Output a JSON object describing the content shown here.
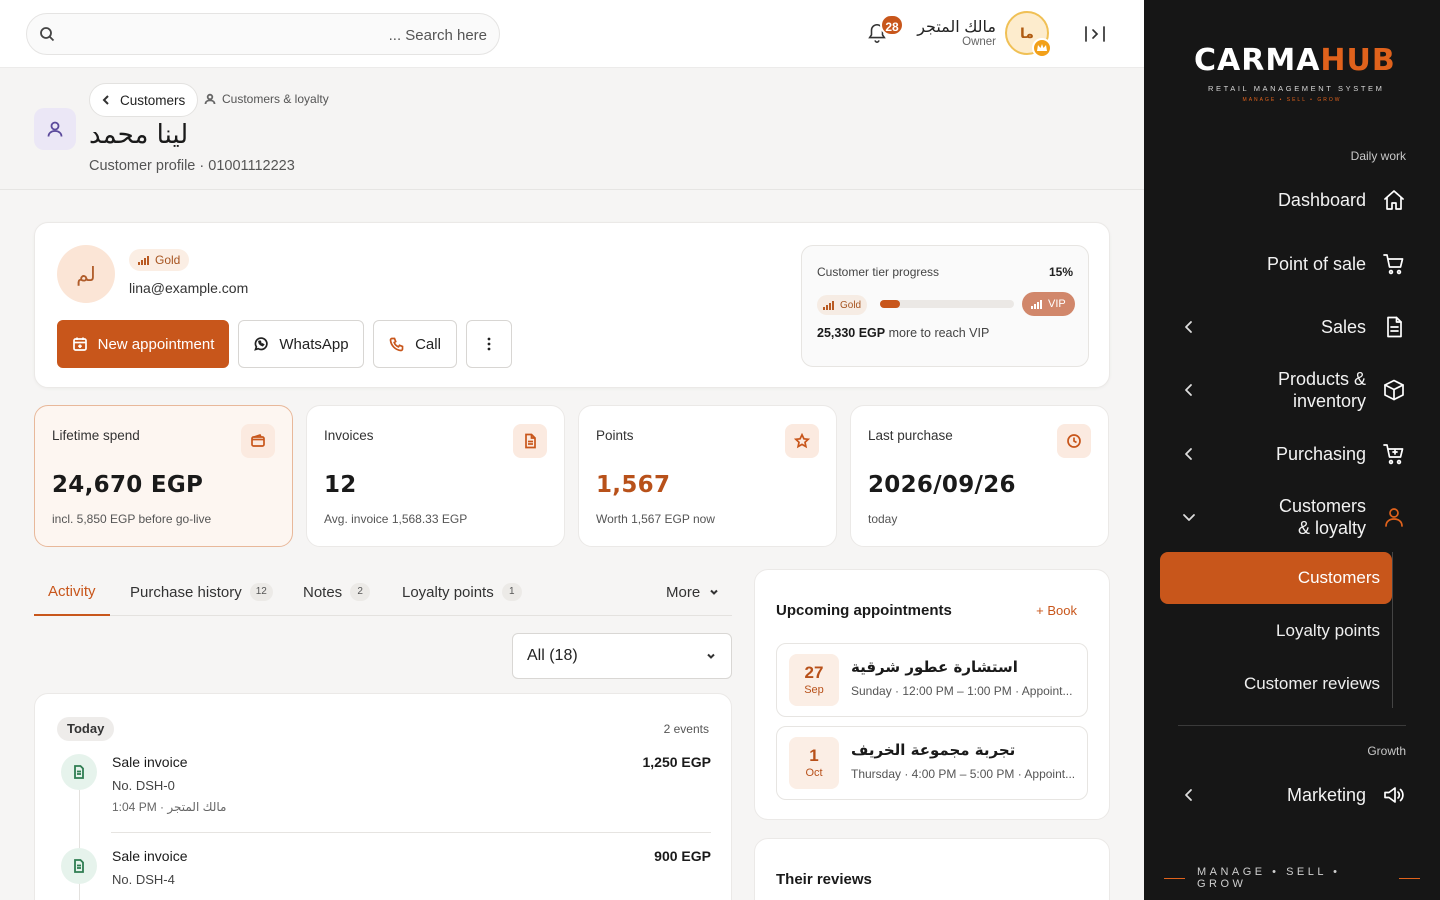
{
  "topbar": {
    "search_placeholder": "... Search here",
    "notifications_count": "28",
    "user_name": "مالك المتجر",
    "user_role": "Owner",
    "user_initials": "ما"
  },
  "page": {
    "back_label": "Customers",
    "breadcrumb_current": "Customers & loyalty",
    "title": "لينا محمد",
    "subtitle": "Customer profile · 01001112223"
  },
  "profile": {
    "initials": "لم",
    "tier": "Gold",
    "email": "lina@example.com",
    "buttons": {
      "new_appointment": "New appointment",
      "whatsapp": "WhatsApp",
      "call": "Call"
    },
    "tier_progress": {
      "label": "Customer tier progress",
      "percent_label": "15%",
      "percent": 15,
      "from": "Gold",
      "to": "VIP",
      "reach_amount": "25,330 EGP",
      "reach_text": "more to reach VIP"
    }
  },
  "stats": [
    {
      "label": "Lifetime spend",
      "value": "24,670 EGP",
      "foot": "incl. 5,850 EGP before go-live",
      "icon": "wallet-icon"
    },
    {
      "label": "Invoices",
      "value": "12",
      "foot": "Avg. invoice 1,568.33 EGP",
      "icon": "document-icon"
    },
    {
      "label": "Points",
      "value": "1,567",
      "foot": "Worth 1,567 EGP now",
      "icon": "star-icon"
    },
    {
      "label": "Last purchase",
      "value": "2026/09/26",
      "foot": "today",
      "icon": "clock-icon"
    }
  ],
  "tabs": [
    {
      "label": "Activity",
      "count": ""
    },
    {
      "label": "Purchase history",
      "count": "12"
    },
    {
      "label": "Notes",
      "count": "2"
    },
    {
      "label": "Loyalty points",
      "count": "1"
    },
    {
      "label": "More",
      "count": ""
    }
  ],
  "filter": {
    "selected": "All (18)"
  },
  "activity": {
    "group_label": "Today",
    "events_count": "2 events",
    "events": [
      {
        "title": "Sale invoice",
        "number": "No. DSH-0",
        "time": "1:04 PM · مالك المتجر",
        "amount": "1,250 EGP"
      },
      {
        "title": "Sale invoice",
        "number": "No. DSH-4",
        "time": "",
        "amount": "900 EGP"
      }
    ]
  },
  "appointments": {
    "title": "Upcoming appointments",
    "book_label": "+ Book",
    "items": [
      {
        "day": "27",
        "month": "Sep",
        "name": "استشارة عطور شرقية",
        "meta": "Sunday · 12:00 PM – 1:00 PM · Appoint..."
      },
      {
        "day": "1",
        "month": "Oct",
        "name": "تجربة مجموعة الخريف",
        "meta": "Thursday · 4:00 PM – 5:00 PM · Appoint..."
      }
    ]
  },
  "reviews": {
    "title": "Their reviews"
  },
  "sidebar": {
    "logo_text_1": "CARMA",
    "logo_text_2": "HUB",
    "logo_sub": "RETAIL MANAGEMENT SYSTEM",
    "logo_tag": "MANAGE • SELL • GROW",
    "section_daily": "Daily work",
    "items": [
      {
        "label": "Dashboard",
        "icon": "home-icon"
      },
      {
        "label": "Point of sale",
        "icon": "cart-icon"
      },
      {
        "label": "Sales",
        "icon": "document-icon"
      },
      {
        "label": "Products & inventory",
        "icon": "box-icon"
      },
      {
        "label": "Purchasing",
        "icon": "cart-plus-icon"
      },
      {
        "label": "Customers & loyalty",
        "icon": "user-icon"
      }
    ],
    "sub_items": [
      {
        "label": "Customers",
        "active": true
      },
      {
        "label": "Loyalty points",
        "active": false
      },
      {
        "label": "Customer reviews",
        "active": false
      }
    ],
    "section_growth": "Growth",
    "marketing": {
      "label": "Marketing",
      "icon": "megaphone-icon"
    },
    "footer": "MANAGE • SELL • GROW"
  },
  "colors": {
    "accent": "#c8561b",
    "sidebar_bg": "#161616",
    "page_bg": "#f6f5f4"
  }
}
